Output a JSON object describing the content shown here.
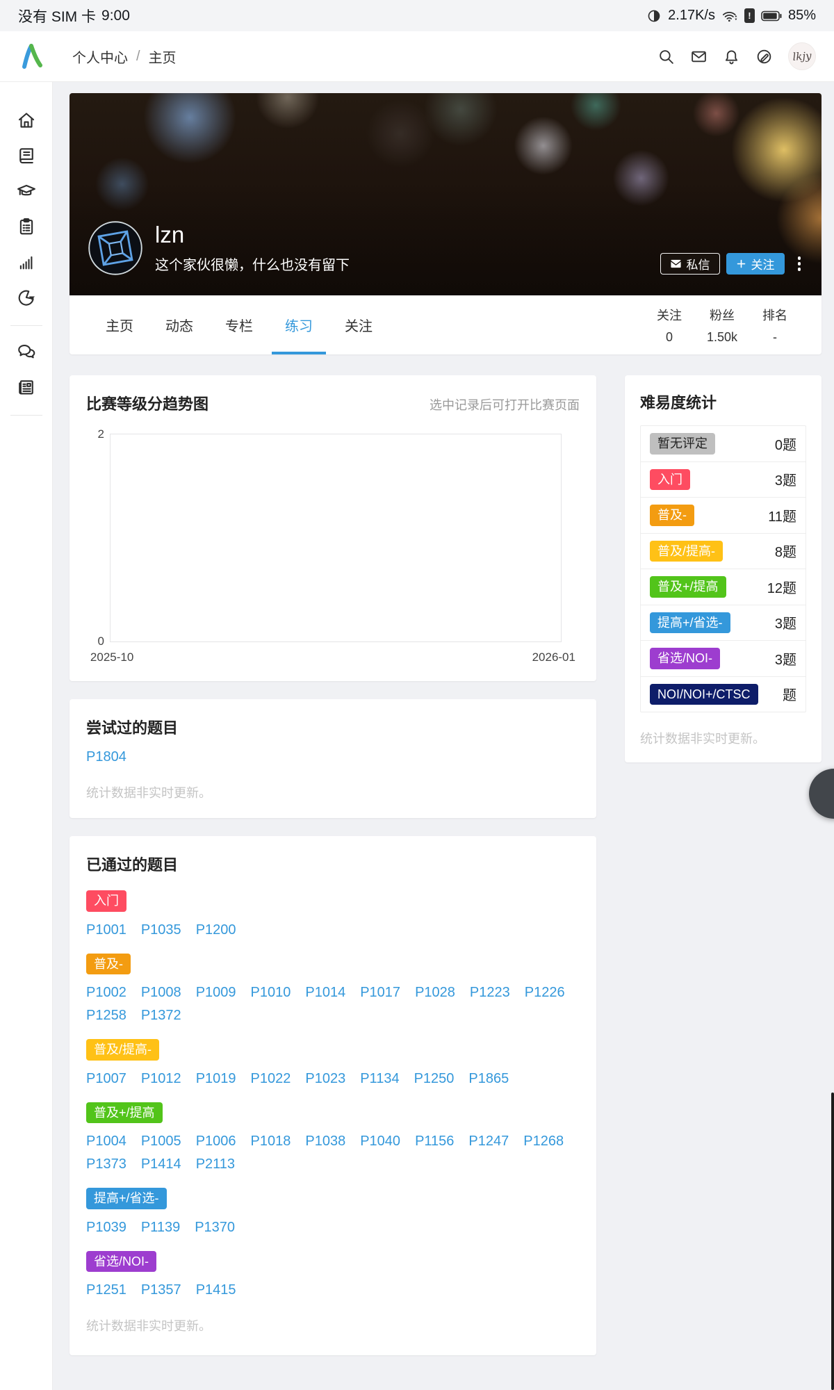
{
  "status_bar": {
    "carrier_text": "没有 SIM 卡",
    "time": "9:00",
    "net_speed": "2.17K/s",
    "battery_percent": "85%",
    "icons": [
      "data-saver-icon",
      "wifi-icon",
      "sim-alert-icon",
      "battery-icon"
    ]
  },
  "header": {
    "logo_icon": "luogu-logo",
    "breadcrumb": {
      "section": "个人中心",
      "separator": "/",
      "page": "主页"
    },
    "icons": [
      "search-icon",
      "mail-icon",
      "bell-icon",
      "pencil-circle-icon"
    ],
    "avatar_text": "lkjy"
  },
  "sidebar": {
    "icons": [
      "home-icon",
      "book-icon",
      "graduation-cap-icon",
      "clipboard-icon",
      "bar-chart-icon",
      "pie-chart-icon",
      "chat-icon",
      "newspaper-icon"
    ]
  },
  "profile": {
    "username": "lzn",
    "bio": "这个家伙很懒，什么也没有留下",
    "message_button": "私信",
    "follow_button": "关注",
    "tabs": [
      {
        "label": "主页",
        "active": false
      },
      {
        "label": "动态",
        "active": false
      },
      {
        "label": "专栏",
        "active": false
      },
      {
        "label": "练习",
        "active": true
      },
      {
        "label": "关注",
        "active": false
      }
    ],
    "stats": [
      {
        "label": "关注",
        "value": "0"
      },
      {
        "label": "粉丝",
        "value": "1.50k"
      },
      {
        "label": "排名",
        "value": "-"
      }
    ]
  },
  "rating_card": {
    "title": "比赛等级分趋势图",
    "hint": "选中记录后可打开比赛页面",
    "y_top": "2",
    "y_bottom": "0",
    "x_left": "2025-10",
    "x_right": "2026-01"
  },
  "chart_data": {
    "type": "line",
    "title": "比赛等级分趋势图",
    "x": [],
    "series": [],
    "xticks": [
      "2025-10",
      "2026-01"
    ],
    "yticks": [
      0,
      2
    ],
    "ylim": [
      0,
      2
    ],
    "grid": false,
    "legend": false
  },
  "difficulty": {
    "title": "难易度统计",
    "rows": [
      {
        "label": "暂无评定",
        "count": "0题",
        "bg": "#bfbfbf",
        "fg": "#222222"
      },
      {
        "label": "入门",
        "count": "3题",
        "bg": "#fe4c61",
        "fg": "#ffffff"
      },
      {
        "label": "普及-",
        "count": "11题",
        "bg": "#f39c11",
        "fg": "#ffffff"
      },
      {
        "label": "普及/提高-",
        "count": "8题",
        "bg": "#ffc116",
        "fg": "#ffffff"
      },
      {
        "label": "普及+/提高",
        "count": "12题",
        "bg": "#52c41a",
        "fg": "#ffffff"
      },
      {
        "label": "提高+/省选-",
        "count": "3题",
        "bg": "#3498db",
        "fg": "#ffffff"
      },
      {
        "label": "省选/NOI-",
        "count": "3题",
        "bg": "#9d3dcf",
        "fg": "#ffffff"
      },
      {
        "label": "NOI/NOI+/CTSC",
        "count": "题",
        "bg": "#0e1d69",
        "fg": "#ffffff"
      }
    ],
    "footer": "统计数据非实时更新。"
  },
  "tried": {
    "title": "尝试过的题目",
    "problems": [
      "P1804"
    ],
    "footer": "统计数据非实时更新。"
  },
  "passed": {
    "title": "已通过的题目",
    "groups": [
      {
        "tag": "入门",
        "bg": "#fe4c61",
        "problems": [
          "P1001",
          "P1035",
          "P1200"
        ]
      },
      {
        "tag": "普及-",
        "bg": "#f39c11",
        "problems": [
          "P1002",
          "P1008",
          "P1009",
          "P1010",
          "P1014",
          "P1017",
          "P1028",
          "P1223",
          "P1226",
          "P1258",
          "P1372"
        ]
      },
      {
        "tag": "普及/提高-",
        "bg": "#ffc116",
        "problems": [
          "P1007",
          "P1012",
          "P1019",
          "P1022",
          "P1023",
          "P1134",
          "P1250",
          "P1865"
        ]
      },
      {
        "tag": "普及+/提高",
        "bg": "#52c41a",
        "problems": [
          "P1004",
          "P1005",
          "P1006",
          "P1018",
          "P1038",
          "P1040",
          "P1156",
          "P1247",
          "P1268",
          "P1373",
          "P1414",
          "P2113"
        ]
      },
      {
        "tag": "提高+/省选-",
        "bg": "#3498db",
        "problems": [
          "P1039",
          "P1139",
          "P1370"
        ]
      },
      {
        "tag": "省选/NOI-",
        "bg": "#9d3dcf",
        "problems": [
          "P1251",
          "P1357",
          "P1415"
        ]
      }
    ],
    "footer": "统计数据非实时更新。"
  },
  "colors": {
    "accent": "#3498db",
    "link": "#3498db"
  }
}
